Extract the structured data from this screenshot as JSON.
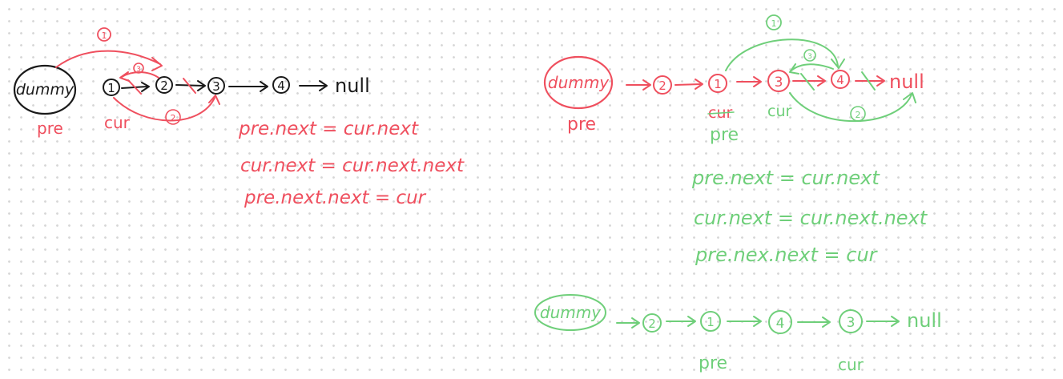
{
  "colors": {
    "black": "#1a1a1a",
    "red": "#ef4f5e",
    "green": "#6fcf7a",
    "background": "#ffffff",
    "dots": "#d6d6d6"
  },
  "diagram1": {
    "dummy": "dummy",
    "nodes": [
      "1",
      "2",
      "3",
      "4"
    ],
    "null": "null",
    "pre": "pre",
    "cur": "cur",
    "step_marks": [
      "1",
      "2",
      "3"
    ],
    "code": [
      "pre.next = cur.next",
      "cur.next = cur.next.next",
      "pre.next.next = cur"
    ]
  },
  "diagram2": {
    "dummy": "dummy",
    "nodes": [
      "2",
      "1",
      "3",
      "4"
    ],
    "null": "null",
    "pre_under_dummy": "pre",
    "cur_under_1": "cur",
    "pre_under_1": "pre",
    "cur_under_3": "cur",
    "step_marks": [
      "1",
      "2",
      "3"
    ],
    "code": [
      "pre.next = cur.next",
      "cur.next = cur.next.next",
      "pre.nex.next = cur"
    ]
  },
  "diagram3": {
    "dummy": "dummy",
    "nodes": [
      "2",
      "1",
      "4",
      "3"
    ],
    "null": "null",
    "pre": "pre",
    "cur": "cur"
  }
}
